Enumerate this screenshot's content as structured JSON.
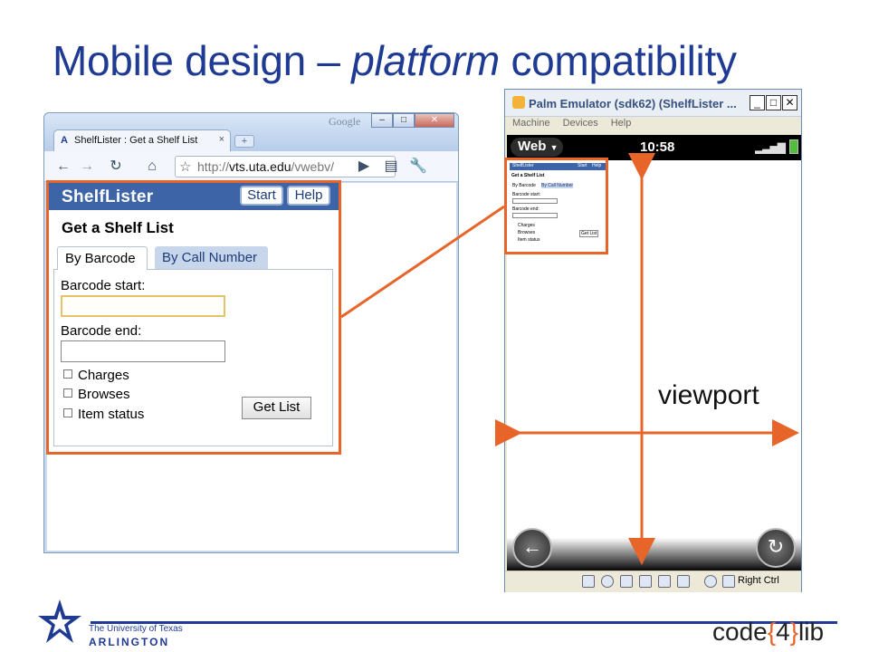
{
  "slide": {
    "title_prefix": "Mobile design – ",
    "title_em": "platform",
    "title_suffix": " compatibility",
    "viewport_label": "viewport"
  },
  "chrome": {
    "google_label": "Google",
    "tab_logo": "A",
    "tab_title": "ShelfLister : Get a Shelf List",
    "tab_close": "×",
    "new_tab": "+",
    "win_min": "–",
    "win_max": "□",
    "win_close": "✕",
    "url_prefix": "http://",
    "url_domain": "vts.uta.edu",
    "url_path": "/vwebv/",
    "icons": [
      "back-icon",
      "forward-icon",
      "reload-icon",
      "home-icon",
      "star-icon",
      "go-icon",
      "page-icon",
      "wrench-icon"
    ]
  },
  "shelflister": {
    "title": "ShelfLister",
    "start_label": "Start",
    "help_label": "Help",
    "heading": "Get a Shelf List",
    "tabs": [
      "By Barcode",
      "By Call Number"
    ],
    "barcode_start_label": "Barcode start:",
    "barcode_end_label": "Barcode end:",
    "checkboxes": [
      "Charges",
      "Browses",
      "Item status"
    ],
    "get_list_label": "Get List"
  },
  "palm": {
    "title": "Palm Emulator (sdk62) (ShelfLister ...",
    "menu": [
      "Machine",
      "Devices",
      "Help"
    ],
    "web_label": "Web",
    "clock": "10:58",
    "right_ctrl": "Right Ctrl",
    "win_min": "_",
    "win_max": "□",
    "win_close": "✕"
  },
  "footer": {
    "uta_line1": "The University of Texas",
    "uta_line2": "ARLINGTON",
    "code": "code",
    "lbrace": "{",
    "four": "4",
    "rbrace": "}",
    "lib": "lib"
  },
  "colors": {
    "title_blue": "#1f3a93",
    "annotation_orange": "#e8652a",
    "shelflister_header": "#3e64a8"
  }
}
